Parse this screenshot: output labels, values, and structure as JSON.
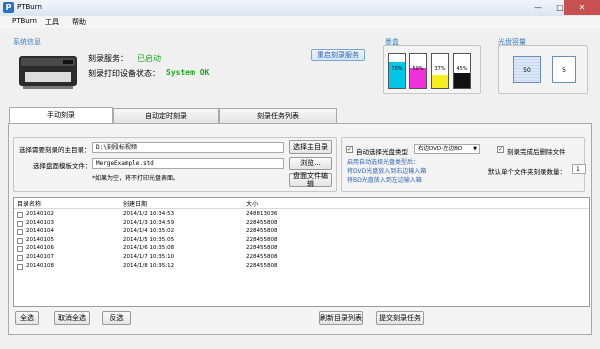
{
  "window": {
    "title": "PTBurn",
    "icon_letter": "P",
    "minimize": "—",
    "maximize": "□",
    "close": "✕"
  },
  "menu": [
    "PTBurn",
    "工具",
    "帮助"
  ],
  "system_info": {
    "label": "系统信息",
    "service_label": "刻录服务：",
    "service_status": "已启动",
    "printer_label": "刻录打印设备状态：",
    "printer_status": "System OK",
    "restart_button": "重启刻录服务"
  },
  "ink": {
    "label": "墨盒",
    "cartridges": [
      {
        "name": "cyan",
        "color": "#00c6e8",
        "percent": "76%",
        "level": 0.76
      },
      {
        "name": "magenta",
        "color": "#f030d8",
        "percent": "59%",
        "level": 0.59
      },
      {
        "name": "yellow",
        "color": "#f6ef1c",
        "percent": "37%",
        "level": 0.37
      },
      {
        "name": "black",
        "color": "#111111",
        "percent": "45%",
        "level": 0.45
      }
    ]
  },
  "disc_capacity": {
    "label": "光盘容量",
    "left_value": "50",
    "right_value": "5"
  },
  "tabs": [
    "手动刻录",
    "自动定时刻录",
    "刻录任务列表"
  ],
  "form": {
    "main_dir_label": "选择需要刻录的主目录：",
    "main_dir_value": "D:\\刻段标视频",
    "template_label": "选择盘面模板文件：",
    "template_value": "MergeExample.std",
    "template_note": "*如果为空，将不打印光盘表面。",
    "select_dir_button": "选择主目录",
    "browse_button": "浏览...",
    "edit_disc_button": "盘面文件编辑",
    "auto_select_label": "自动选择光盘类型",
    "disc_type_value": "右边DVD-左边BD",
    "delete_after_label": "刻录完成后删除文件",
    "hint_line1": "启用自动选择光盘类型后：",
    "hint_line2": "将DVD光盘放入到右边输入箱",
    "hint_line3": "将BD光盘放入到左边输入箱",
    "copies_label": "默认单个文件夹刻录数量：",
    "copies_value": "1"
  },
  "file_list": {
    "columns": [
      "目录名称",
      "创建日期",
      "大小"
    ],
    "rows": [
      {
        "name": "20140102",
        "date": "2014/1/2 10:34:53",
        "size": "248813036"
      },
      {
        "name": "20140103",
        "date": "2014/1/3 10:34:59",
        "size": "228455808"
      },
      {
        "name": "20140104",
        "date": "2014/1/4 10:35:02",
        "size": "228455808"
      },
      {
        "name": "20140105",
        "date": "2014/1/5 10:35:05",
        "size": "228455808"
      },
      {
        "name": "20140106",
        "date": "2014/1/6 10:35:08",
        "size": "228455808"
      },
      {
        "name": "20140107",
        "date": "2014/1/7 10:35:10",
        "size": "228455808"
      },
      {
        "name": "20140108",
        "date": "2014/1/8 10:35:12",
        "size": "228455808"
      }
    ]
  },
  "bottom_buttons": {
    "select_all": "全选",
    "deselect_all": "取消全选",
    "invert": "反选",
    "refresh": "刷新目录列表",
    "submit": "提交刻录任务"
  }
}
